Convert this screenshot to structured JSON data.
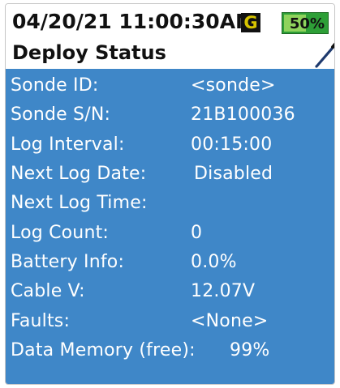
{
  "header": {
    "datetime": "04/20/21  11:00:30AM",
    "gps_badge": "G",
    "battery": {
      "label": "50%",
      "level_percent": 50,
      "color": "#2e9f37"
    },
    "title": "Deploy Status",
    "pen_icon": "pen-icon"
  },
  "status": {
    "sonde_id": {
      "label": "Sonde ID:",
      "value": "<sonde>"
    },
    "sonde_sn": {
      "label": "Sonde S/N:",
      "value": "21B100036"
    },
    "log_interval": {
      "label": "Log Interval:",
      "value": "00:15:00"
    },
    "next_log_date": {
      "label": "Next Log Date:",
      "value": "Disabled"
    },
    "next_log_time": {
      "label": "Next Log Time:",
      "value": ""
    },
    "log_count": {
      "label": "Log Count:",
      "value": "0"
    },
    "battery_info": {
      "label": "Battery Info:",
      "value": "0.0%"
    },
    "cable_v": {
      "label": "Cable V:",
      "value": "12.07V"
    },
    "faults": {
      "label": "Faults:",
      "value": "<None>"
    },
    "data_memory": {
      "label": "Data Memory (free):",
      "value": "99%"
    }
  },
  "colors": {
    "panel": "#3f87c8",
    "text": "#ffffff"
  }
}
